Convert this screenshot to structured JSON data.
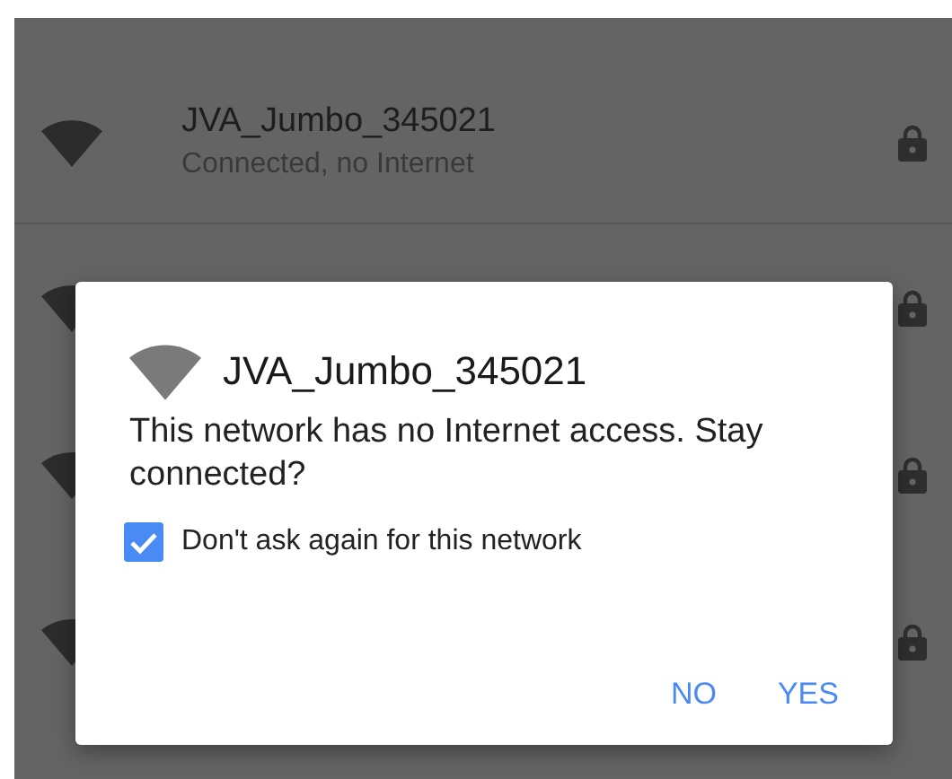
{
  "networks": [
    {
      "name": "JVA_Jumbo_345021",
      "status": "Connected, no Internet",
      "secured": true
    },
    {
      "secured": true
    },
    {
      "secured": true
    },
    {
      "secured": true
    }
  ],
  "dialog": {
    "title": "JVA_Jumbo_345021",
    "message": "This network has no Internet access. Stay connected?",
    "checkbox": {
      "label": "Don't ask again for this network",
      "checked": true
    },
    "buttons": [
      "NO",
      "YES"
    ]
  }
}
